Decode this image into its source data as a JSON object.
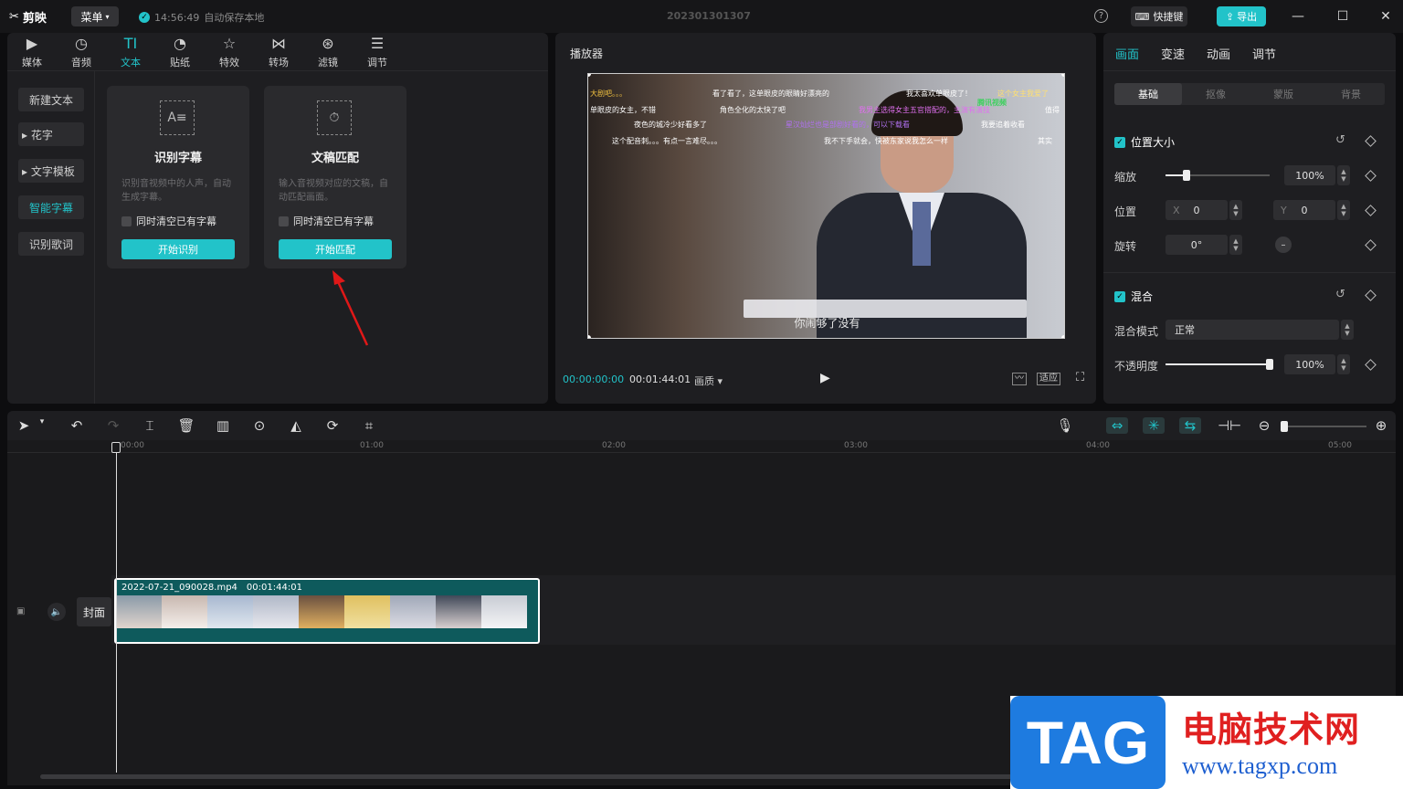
{
  "app": {
    "logo": "剪映",
    "menu": "菜单",
    "autosave_time": "14:56:49",
    "autosave_text": "自动保存本地",
    "project_name": "202301301307",
    "help": "?",
    "shortcut": "快捷键",
    "export": "导出",
    "accent": "#22c3c9"
  },
  "media_tabs": [
    {
      "icon": "▶",
      "label": "媒体"
    },
    {
      "icon": "◷",
      "label": "音频"
    },
    {
      "icon": "TI",
      "label": "文本"
    },
    {
      "icon": "◔",
      "label": "贴纸"
    },
    {
      "icon": "☆",
      "label": "特效"
    },
    {
      "icon": "⋈",
      "label": "转场"
    },
    {
      "icon": "⊛",
      "label": "滤镜"
    },
    {
      "icon": "☰",
      "label": "调节"
    }
  ],
  "text_nav": [
    "新建文本",
    "▸ 花字",
    "▸ 文字模板",
    "智能字幕",
    "识别歌词"
  ],
  "cards": [
    {
      "title": "识别字幕",
      "desc": "识别音视频中的人声，自动生成字幕。",
      "check": "同时清空已有字幕",
      "button": "开始识别"
    },
    {
      "title": "文稿匹配",
      "desc": "输入音视频对应的文稿，自动匹配画面。",
      "check": "同时清空已有字幕",
      "button": "开始匹配"
    }
  ],
  "player": {
    "title": "播放器",
    "current_time": "00:00:00:00",
    "total_time": "00:01:44:01",
    "quality": "画质 ▾",
    "fit": "适应",
    "subtitle": "你闹够了没有",
    "danmu": [
      "大剧吧。。。",
      "看了看了，这单眼皮的眼睛好漂亮的",
      "我太喜欢单眼皮了！",
      "这个女主我爱了",
      "腾讯视频",
      "单眼皮的女主，不错",
      "角色全化的太快了吧",
      "我男主选得女主五官搭配的，主演有演技",
      "值得",
      "夜色的城冷少好看多了",
      "星汉灿烂也是部剧好看的，可以下载看",
      "我要追着收看",
      "这个配音刺。。。有点一言难尽。。。",
      "我不下手就会，快被东家说我怎么一样",
      "其实"
    ]
  },
  "right": {
    "tabs": [
      "画面",
      "变速",
      "动画",
      "调节"
    ],
    "subtabs": [
      "基础",
      "抠像",
      "蒙版",
      "背景"
    ],
    "section1": "位置大小",
    "scale_label": "缩放",
    "scale_value": "100%",
    "scale_pct": 0.2,
    "position_label": "位置",
    "x_label": "X",
    "x_value": "0",
    "y_label": "Y",
    "y_value": "0",
    "rotate_label": "旋转",
    "rotate_value": "0°",
    "section2": "混合",
    "blend_label": "混合模式",
    "blend_value": "正常",
    "opacity_label": "不透明度",
    "opacity_value": "100%",
    "opacity_pct": 1.0
  },
  "timeline": {
    "ruler": [
      "00:00",
      "01:00",
      "02:00",
      "03:00",
      "04:00",
      "05:00"
    ],
    "clip_name": "2022-07-21_090028.mp4",
    "clip_duration": "00:01:44:01",
    "cover": "封面"
  },
  "watermark": {
    "tag": "TAG",
    "site_cn": "电脑技术网",
    "url": "www.tagxp.com"
  }
}
